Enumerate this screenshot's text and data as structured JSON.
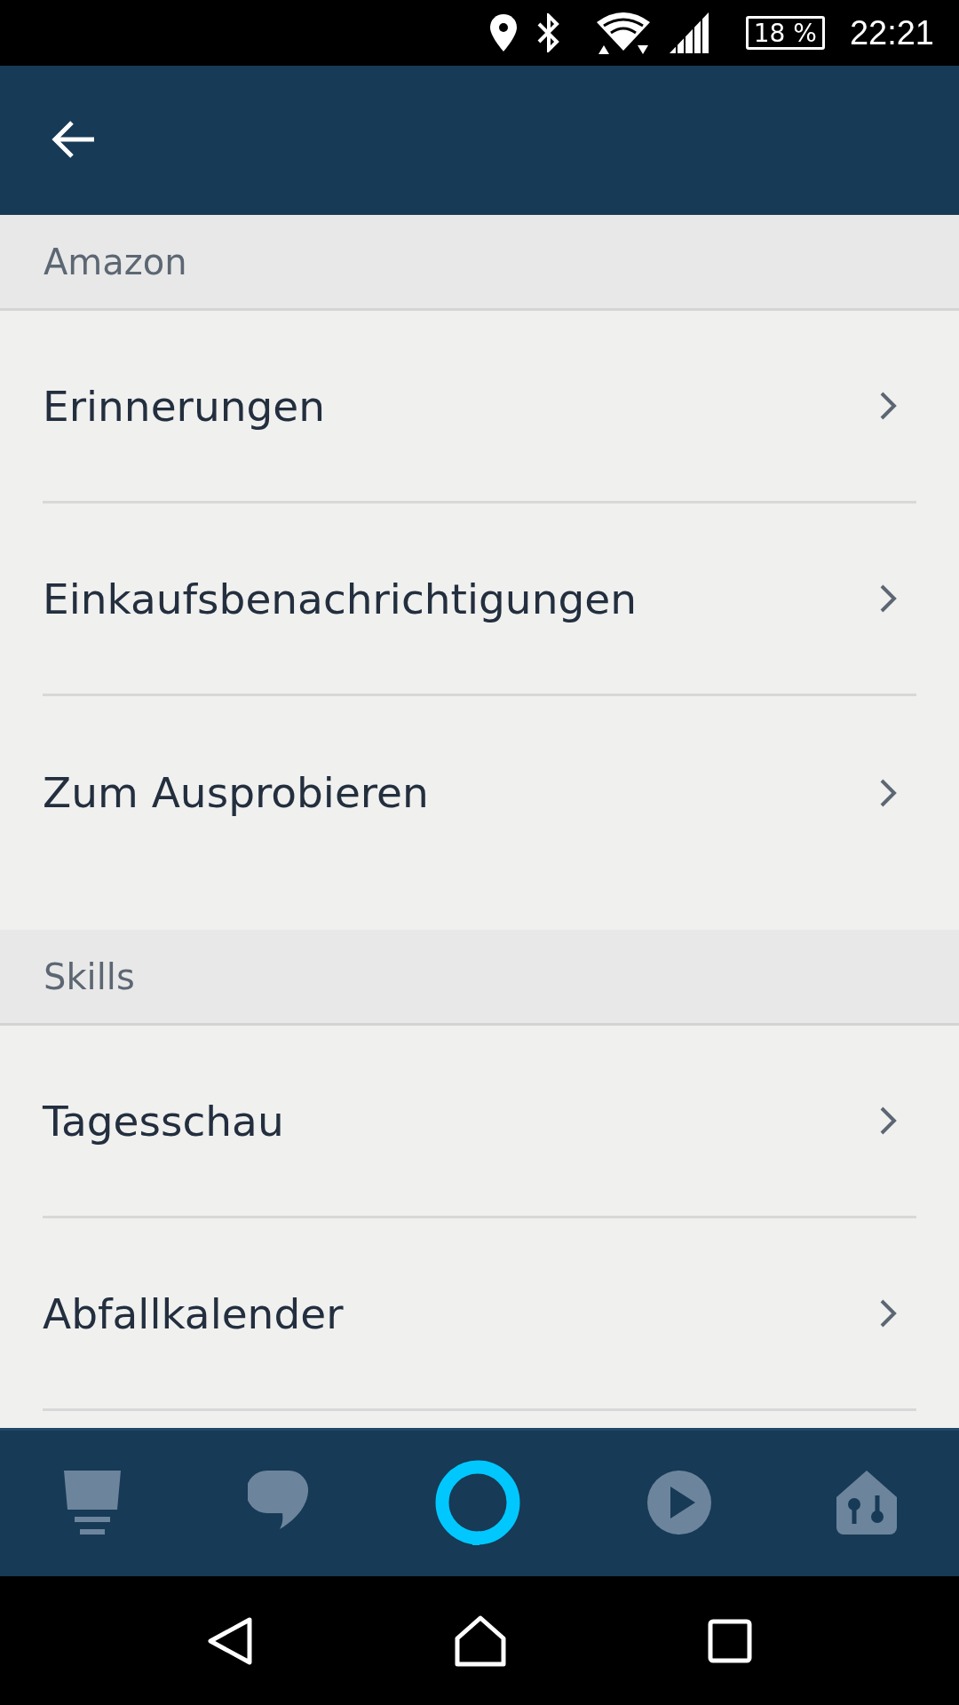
{
  "status_bar": {
    "battery": "18 %",
    "time": "22:21"
  },
  "sections": [
    {
      "title": "Amazon",
      "items": [
        {
          "label": "Erinnerungen"
        },
        {
          "label": "Einkaufsbenachrichtigungen"
        },
        {
          "label": "Zum Ausprobieren"
        }
      ]
    },
    {
      "title": "Skills",
      "items": [
        {
          "label": "Tagesschau"
        },
        {
          "label": "Abfallkalender"
        }
      ]
    }
  ]
}
